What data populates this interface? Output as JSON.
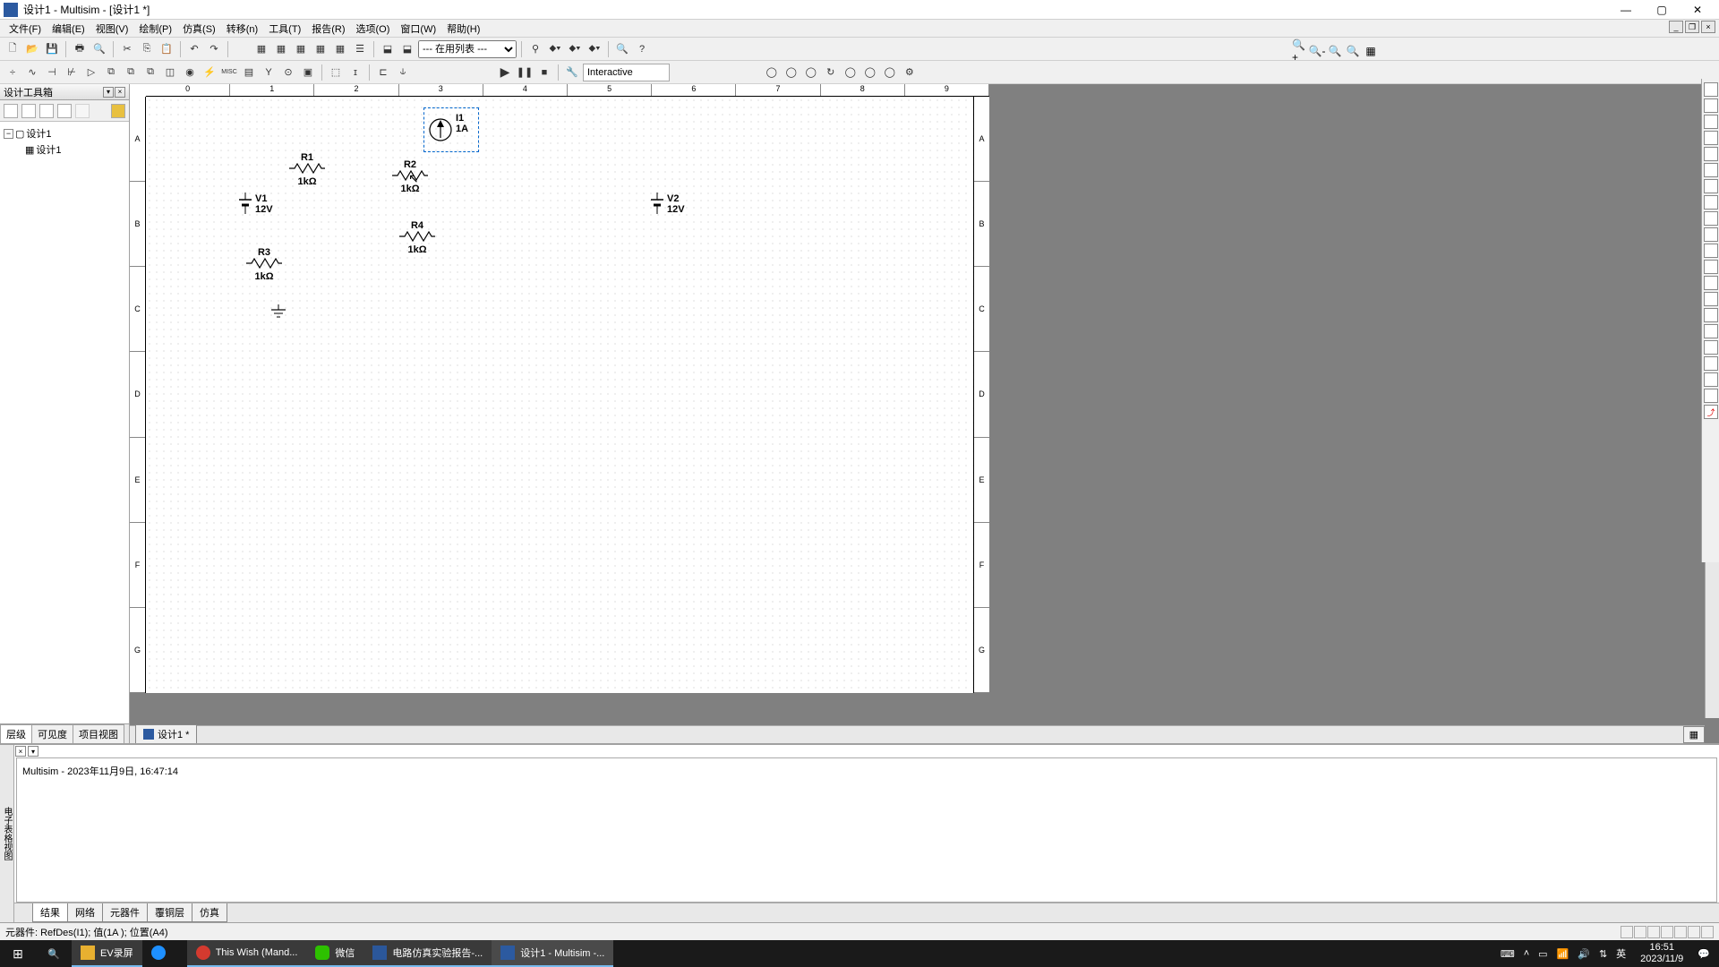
{
  "window": {
    "title": "设计1 - Multisim - [设计1 *]"
  },
  "menu": {
    "items": [
      "文件(F)",
      "编辑(E)",
      "视图(V)",
      "绘制(P)",
      "仿真(S)",
      "转移(n)",
      "工具(T)",
      "报告(R)",
      "选项(O)",
      "窗口(W)",
      "帮助(H)"
    ]
  },
  "toolbar1": {
    "in_use_list": "--- 在用列表 ---"
  },
  "sim": {
    "mode": "Interactive"
  },
  "left_panel": {
    "title": "设计工具箱",
    "root": "设计1",
    "child": "设计1",
    "tabs": [
      "层级",
      "可见度",
      "项目视图"
    ]
  },
  "canvas": {
    "ruler_h": [
      "0",
      "1",
      "2",
      "3",
      "4",
      "5",
      "6",
      "7",
      "8",
      "9"
    ],
    "ruler_v": [
      "A",
      "B",
      "C",
      "D",
      "E",
      "F",
      "G"
    ],
    "tab_label": "设计1 *"
  },
  "components": {
    "I1": {
      "name": "I1",
      "value": "1A"
    },
    "R1": {
      "name": "R1",
      "value": "1kΩ"
    },
    "R2": {
      "name": "R2",
      "value": "1kΩ"
    },
    "R3": {
      "name": "R3",
      "value": "1kΩ"
    },
    "R4": {
      "name": "R4",
      "value": "1kΩ"
    },
    "V1": {
      "name": "V1",
      "value": "12V"
    },
    "V2": {
      "name": "V2",
      "value": "12V"
    }
  },
  "spreadsheet": {
    "log": "Multisim  -  2023年11月9日, 16:47:14",
    "vlabel": "电子表格视图",
    "tabs": [
      "结果",
      "网络",
      "元器件",
      "覆铜层",
      "仿真"
    ]
  },
  "statusbar": {
    "text": "元器件: RefDes(I1); 值(1A ); 位置(A4)"
  },
  "taskbar": {
    "items": [
      {
        "label": "EV录屏",
        "color": "#e8b030"
      },
      {
        "label": "",
        "color": "#1e90ff"
      },
      {
        "label": "This Wish (Mand...",
        "color": "#d43a2f"
      },
      {
        "label": "微信",
        "color": "#2dc100"
      },
      {
        "label": "电路仿真实验报告-...",
        "color": "#2b579a"
      },
      {
        "label": "设计1 - Multisim -...",
        "color": "#2c5aa0"
      }
    ],
    "ime": "英",
    "time": "16:51",
    "date": "2023/11/9"
  }
}
